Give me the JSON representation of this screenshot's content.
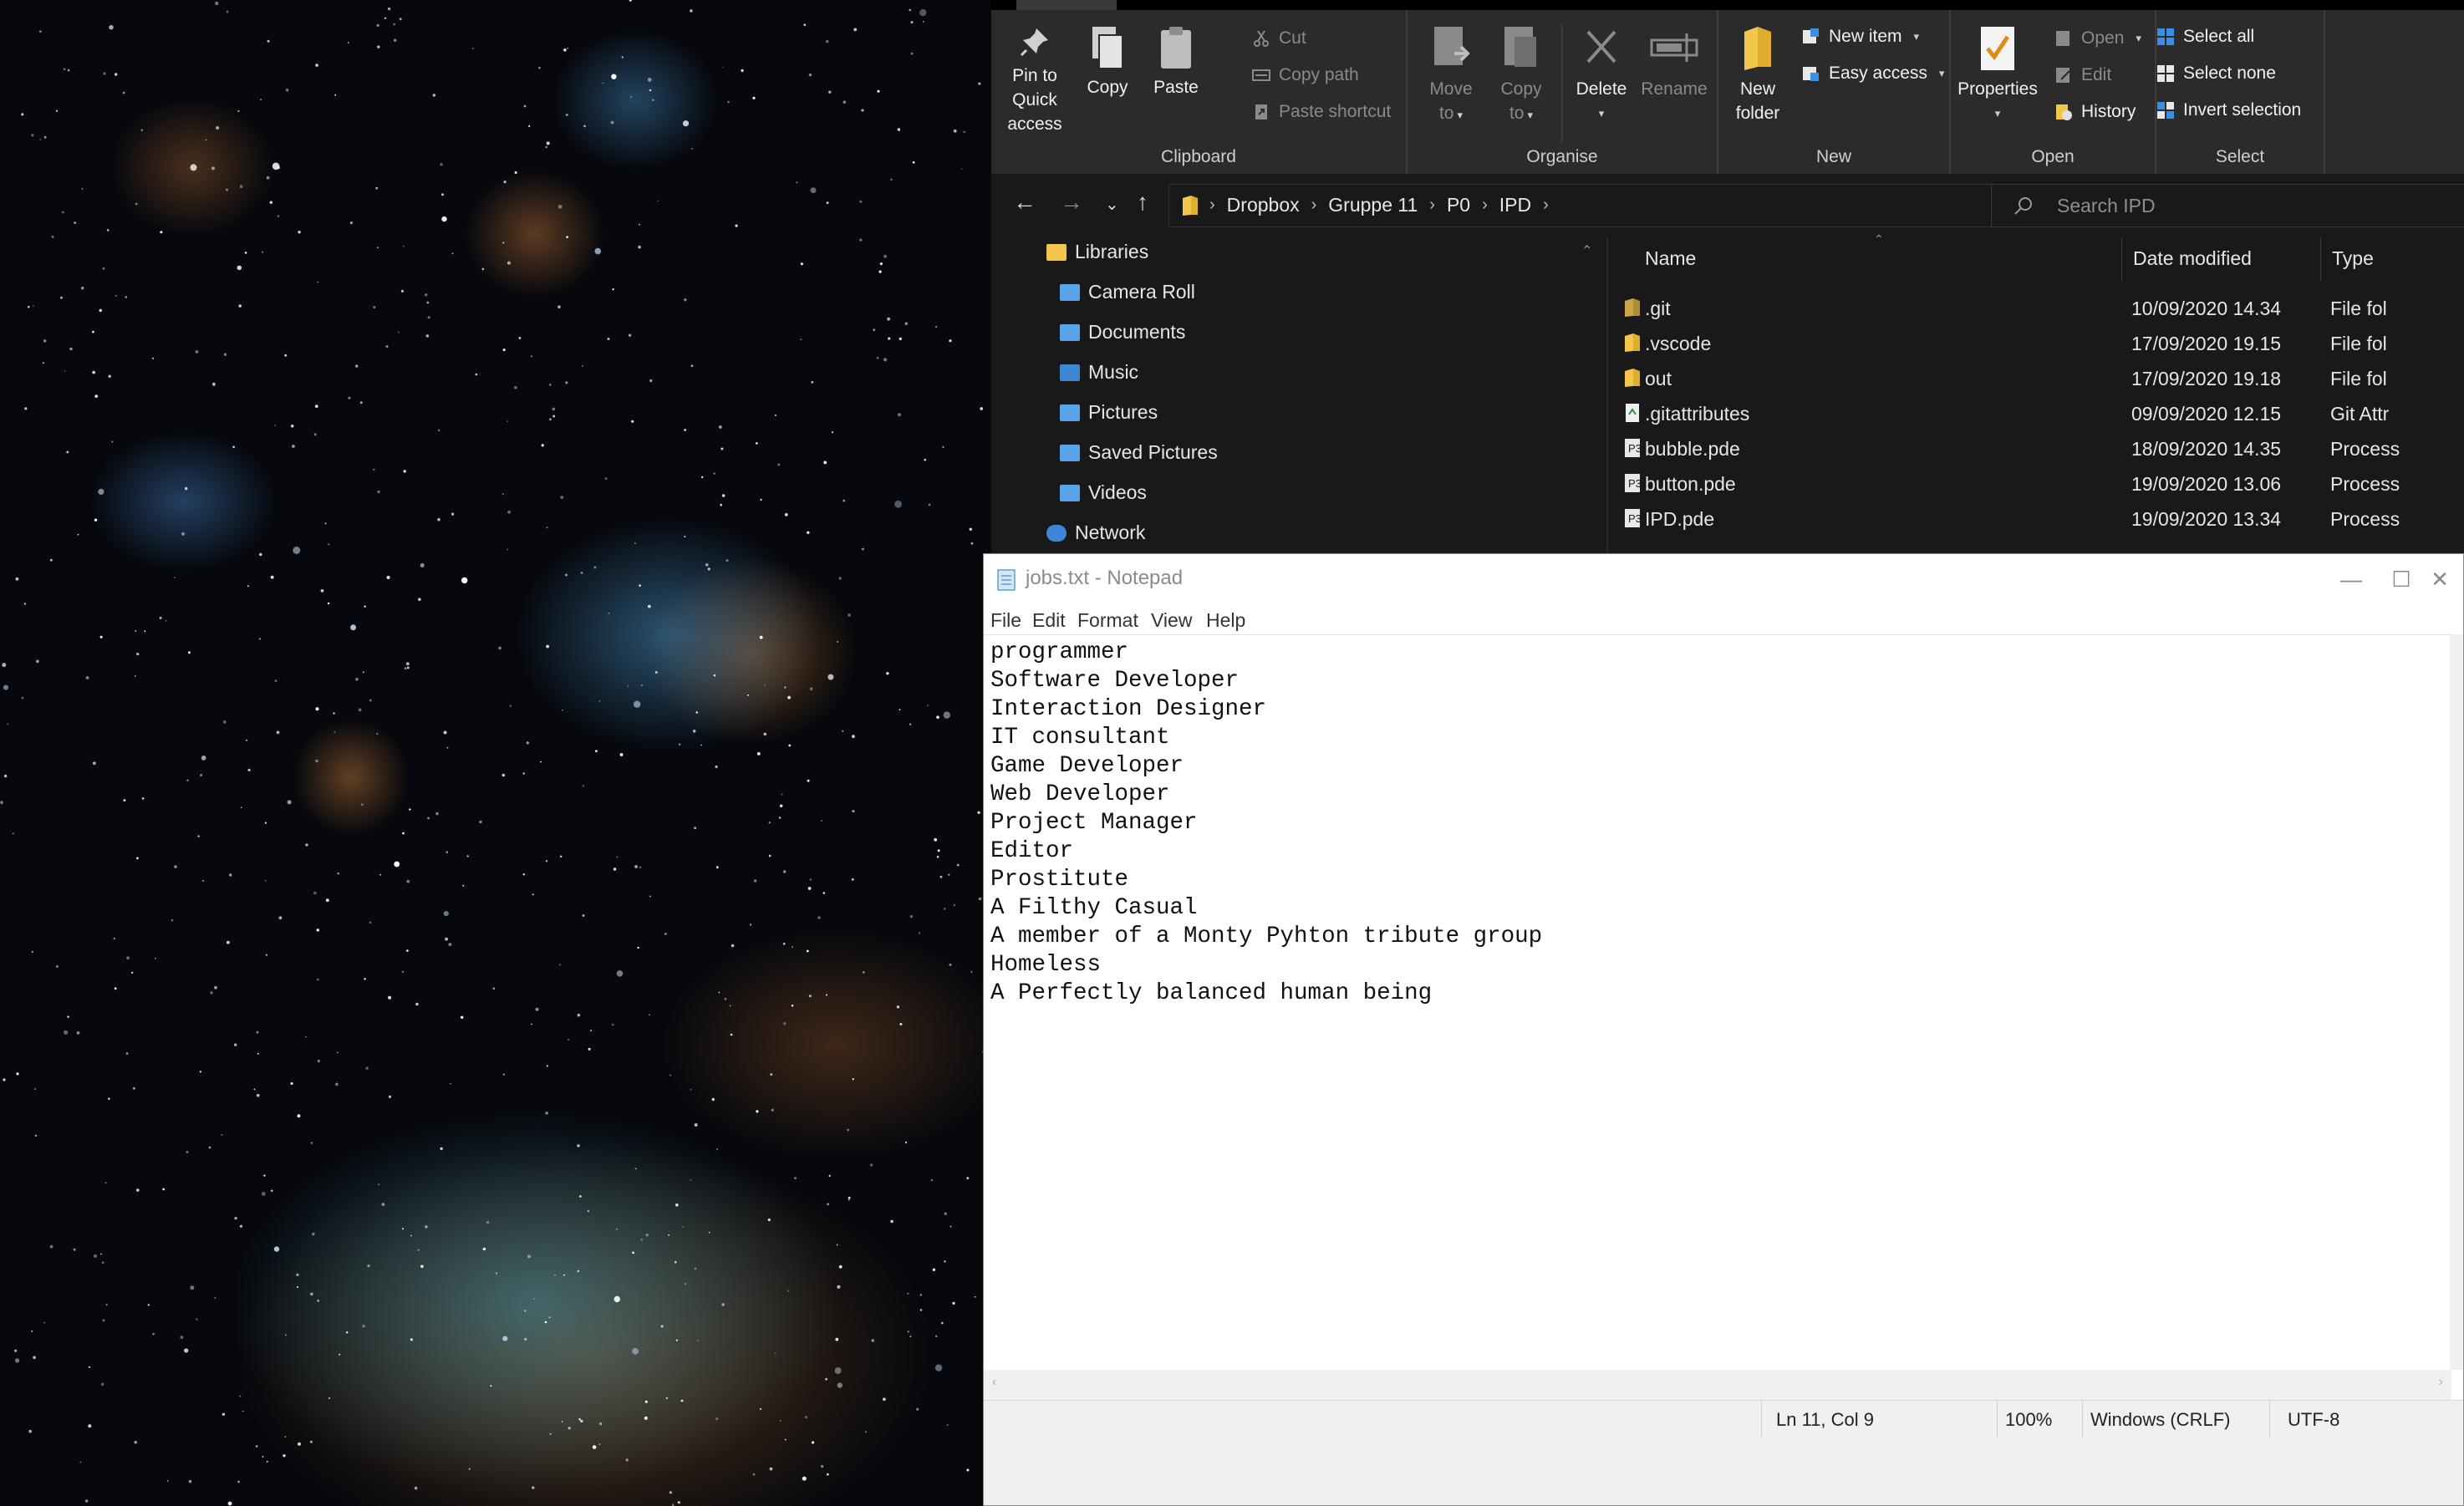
{
  "explorer": {
    "ribbon": {
      "clipboard": {
        "label": "Clipboard",
        "pin_label_1": "Pin to Quick",
        "pin_label_2": "access",
        "copy_label": "Copy",
        "paste_label": "Paste",
        "cut_label": "Cut",
        "copy_path_label": "Copy path",
        "paste_shortcut_label": "Paste shortcut"
      },
      "organise": {
        "label": "Organise",
        "move_label_1": "Move",
        "move_label_2": "to",
        "copy_to_label_1": "Copy",
        "copy_to_label_2": "to",
        "delete_label": "Delete",
        "rename_label": "Rename"
      },
      "new": {
        "label": "New",
        "new_folder_label_1": "New",
        "new_folder_label_2": "folder",
        "new_item_label": "New item",
        "easy_access_label": "Easy access"
      },
      "open": {
        "label": "Open",
        "properties_label": "Properties",
        "open_label": "Open",
        "edit_label": "Edit",
        "history_label": "History"
      },
      "select": {
        "label": "Select",
        "select_all_label": "Select all",
        "select_none_label": "Select none",
        "invert_label": "Invert selection"
      }
    },
    "address": {
      "crumbs": [
        "Dropbox",
        "Gruppe 11",
        "P0",
        "IPD"
      ],
      "search_placeholder": "Search IPD"
    },
    "nav": {
      "items": [
        {
          "label": "Libraries",
          "icon": "libraries-icon"
        },
        {
          "label": "Camera Roll",
          "icon": "library-folder-icon"
        },
        {
          "label": "Documents",
          "icon": "library-folder-icon"
        },
        {
          "label": "Music",
          "icon": "music-library-icon"
        },
        {
          "label": "Pictures",
          "icon": "library-folder-icon"
        },
        {
          "label": "Saved Pictures",
          "icon": "library-folder-icon"
        },
        {
          "label": "Videos",
          "icon": "library-folder-icon"
        },
        {
          "label": "Network",
          "icon": "network-icon"
        }
      ]
    },
    "files": {
      "columns": {
        "name": "Name",
        "date": "Date modified",
        "type": "Type"
      },
      "rows": [
        {
          "name": ".git",
          "date": "10/09/2020 14.34",
          "type": "File fol",
          "icon": "folder-icon"
        },
        {
          "name": ".vscode",
          "date": "17/09/2020 19.15",
          "type": "File fol",
          "icon": "folder-icon"
        },
        {
          "name": "out",
          "date": "17/09/2020 19.18",
          "type": "File fol",
          "icon": "folder-icon"
        },
        {
          "name": ".gitattributes",
          "date": "09/09/2020 12.15",
          "type": "Git Attr",
          "icon": "file-icon"
        },
        {
          "name": "bubble.pde",
          "date": "18/09/2020 14.35",
          "type": "Process",
          "icon": "processing-file-icon"
        },
        {
          "name": "button.pde",
          "date": "19/09/2020 13.06",
          "type": "Process",
          "icon": "processing-file-icon"
        },
        {
          "name": "IPD.pde",
          "date": "19/09/2020 13.34",
          "type": "Process",
          "icon": "processing-file-icon"
        }
      ]
    }
  },
  "notepad": {
    "title": "jobs.txt - Notepad",
    "menu": [
      "File",
      "Edit",
      "Format",
      "View",
      "Help"
    ],
    "lines": [
      "programmer",
      "Software Developer",
      "Interaction Designer",
      "IT consultant",
      "Game Developer",
      "Web Developer",
      "Project Manager",
      "Editor",
      "Prostitute",
      "A Filthy Casual",
      "A member of a Monty Pyhton tribute group",
      "Homeless",
      "A Perfectly balanced human being"
    ],
    "status": {
      "position": "Ln 11, Col 9",
      "zoom": "100%",
      "line_ending": "Windows (CRLF)",
      "encoding": "UTF-8"
    }
  },
  "colors": {
    "explorer_bg": "#191919",
    "ribbon_bg": "#2b2b2b",
    "folder_yellow": "#f2c54b",
    "select_blue": "#3a8ee6"
  }
}
